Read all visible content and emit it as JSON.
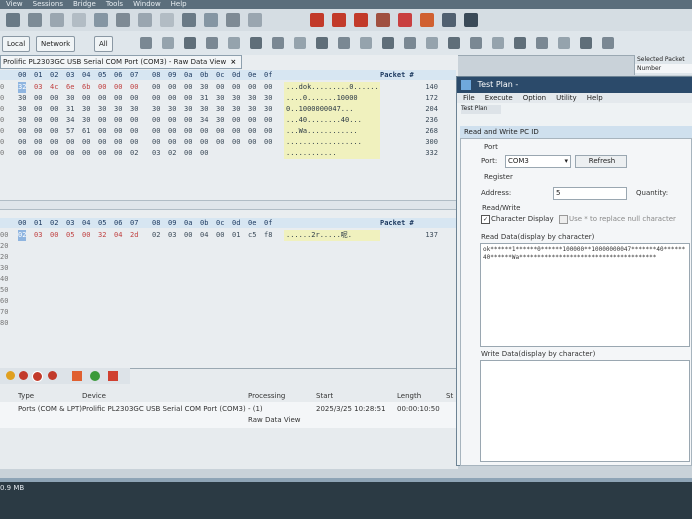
{
  "menubar": [
    "View",
    "Sessions",
    "Bridge",
    "Tools",
    "Window",
    "Help"
  ],
  "toolbar2": {
    "local": "Local",
    "network": "Network",
    "all": "All"
  },
  "tab": {
    "title": "Prolific PL2303GC USB Serial COM Port (COM3) - Raw Data View"
  },
  "hex_top": {
    "header": [
      "00",
      "01",
      "02",
      "03",
      "04",
      "05",
      "06",
      "07",
      "08",
      "09",
      "0a",
      "0b",
      "0c",
      "0d",
      "0e",
      "0f"
    ],
    "packet_label": "Packet #",
    "rows": [
      {
        "idx": "0",
        "hex": [
          "32",
          "03",
          "4c",
          "6e",
          "6b",
          "00",
          "00",
          "00",
          "00",
          "00",
          "00",
          "30",
          "00",
          "00",
          "00",
          "00"
        ],
        "ascii": "...dok.........0......",
        "pkt": "140"
      },
      {
        "idx": "0",
        "hex": [
          "30",
          "00",
          "00",
          "30",
          "00",
          "00",
          "00",
          "00",
          "00",
          "00",
          "00",
          "31",
          "30",
          "30",
          "30",
          "30"
        ],
        "ascii": "....0.......10000",
        "pkt": "172"
      },
      {
        "idx": "0",
        "hex": [
          "30",
          "00",
          "00",
          "31",
          "30",
          "30",
          "30",
          "30",
          "30",
          "30",
          "30",
          "30",
          "30",
          "30",
          "30",
          "30"
        ],
        "ascii": "0..1000000047...",
        "pkt": "204"
      },
      {
        "idx": "0",
        "hex": [
          "30",
          "00",
          "00",
          "34",
          "30",
          "00",
          "00",
          "00",
          "00",
          "00",
          "00",
          "34",
          "30",
          "00",
          "00",
          "00"
        ],
        "ascii": "...40........40...",
        "pkt": "236"
      },
      {
        "idx": "0",
        "hex": [
          "00",
          "00",
          "00",
          "57",
          "61",
          "00",
          "00",
          "00",
          "00",
          "00",
          "00",
          "00",
          "00",
          "00",
          "00",
          "00"
        ],
        "ascii": "...Wa............",
        "pkt": "268"
      },
      {
        "idx": "0",
        "hex": [
          "00",
          "00",
          "00",
          "00",
          "00",
          "00",
          "00",
          "00",
          "00",
          "00",
          "00",
          "00",
          "00",
          "00",
          "00",
          "00"
        ],
        "ascii": "..................",
        "pkt": "300"
      },
      {
        "idx": "0",
        "hex": [
          "00",
          "00",
          "00",
          "00",
          "00",
          "00",
          "00",
          "02",
          "03",
          "02",
          "00",
          "00",
          "",
          "",
          "",
          ""
        ],
        "ascii": "............",
        "pkt": "332"
      }
    ]
  },
  "hex_bottom": {
    "header": [
      "00",
      "01",
      "02",
      "03",
      "04",
      "05",
      "06",
      "07",
      "08",
      "09",
      "0a",
      "0b",
      "0c",
      "0d",
      "0e",
      "0f"
    ],
    "packet_label": "Packet #",
    "rows": [
      {
        "idx": "00",
        "hex": [
          "02",
          "03",
          "00",
          "05",
          "00",
          "32",
          "04",
          "2d",
          "02",
          "03",
          "00",
          "04",
          "00",
          "01",
          "c5",
          "f8"
        ],
        "ascii": "......2r.....呢.",
        "pkt": "137"
      },
      {
        "idx": "20",
        "hex": [],
        "ascii": "",
        "pkt": ""
      },
      {
        "idx": "20",
        "hex": [],
        "ascii": "",
        "pkt": ""
      },
      {
        "idx": "30",
        "hex": [],
        "ascii": "",
        "pkt": ""
      },
      {
        "idx": "40",
        "hex": [],
        "ascii": "",
        "pkt": ""
      },
      {
        "idx": "50",
        "hex": [],
        "ascii": "",
        "pkt": ""
      },
      {
        "idx": "60",
        "hex": [],
        "ascii": "",
        "pkt": ""
      },
      {
        "idx": "70",
        "hex": [],
        "ascii": "",
        "pkt": ""
      },
      {
        "idx": "80",
        "hex": [],
        "ascii": "",
        "pkt": ""
      }
    ]
  },
  "testplan": {
    "title": "Test Plan -",
    "menu": [
      "File",
      "Execute",
      "Option",
      "Utility",
      "Help"
    ],
    "sub": "Test Plan",
    "panel_title": "Read and Write PC ID",
    "port_group": "Port",
    "port_label": "Port:",
    "port_value": "COM3",
    "refresh": "Refresh",
    "register_group": "Register",
    "address_label": "Address:",
    "address_value": "5",
    "quantity_label": "Quantity:",
    "rw_group": "Read/Write",
    "char_display": "Character Display",
    "use_star": "Use * to replace null character",
    "read_label": "Read Data(display by character)",
    "read_value": "ok******1******0******100000**10000000047*******40******40******Wa**************************************",
    "write_label": "Write Data(display by character)"
  },
  "right_panel": {
    "title": "Selected Packet",
    "col": "Number"
  },
  "bottom": {
    "columns": [
      "Type",
      "Device",
      "Processing",
      "Start",
      "Length",
      "St"
    ],
    "row": {
      "type": "Ports (COM & LPT)",
      "device": "Prolific PL2303GC USB Serial COM Port (COM3)",
      "processing": "- (1)",
      "processing2": "Raw Data View",
      "start": "2025/3/25 10:28:51",
      "length": "00:00:10:50"
    }
  },
  "status": "0.9 MB",
  "colors": {
    "accent": "#2b4a6a",
    "highlight": "#f2f2a8",
    "hexheader": "#d7e6f2"
  }
}
